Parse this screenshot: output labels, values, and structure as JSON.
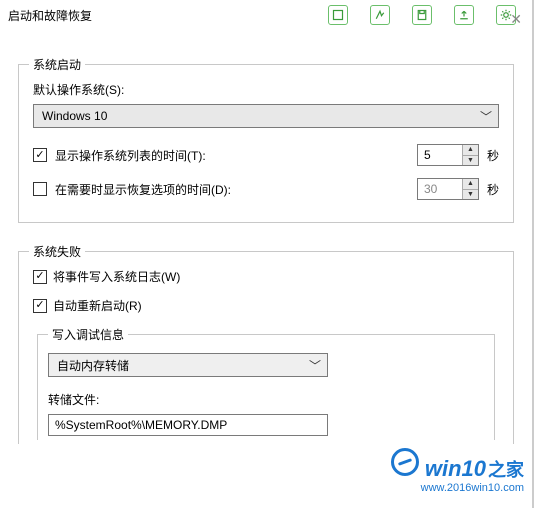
{
  "title": "启动和故障恢复",
  "close": "✕",
  "startup": {
    "legend": "系统启动",
    "default_os_label": "默认操作系统(S):",
    "os_value": "Windows 10",
    "show_list": {
      "checked": true,
      "label": "显示操作系统列表的时间(T):",
      "value": "5",
      "unit": "秒"
    },
    "show_recovery": {
      "checked": false,
      "label": "在需要时显示恢复选项的时间(D):",
      "value": "30",
      "unit": "秒"
    }
  },
  "failure": {
    "legend": "系统失败",
    "write_event": {
      "checked": true,
      "label": "将事件写入系统日志(W)"
    },
    "auto_restart": {
      "checked": true,
      "label": "自动重新启动(R)"
    },
    "debug": {
      "legend": "写入调试信息",
      "select_value": "自动内存转储",
      "dump_label": "转储文件:",
      "dump_value": "%SystemRoot%\\MEMORY.DMP"
    }
  },
  "watermark": {
    "brand1": "win10",
    "brand2": "之家",
    "url": "www.2016win10.com"
  }
}
